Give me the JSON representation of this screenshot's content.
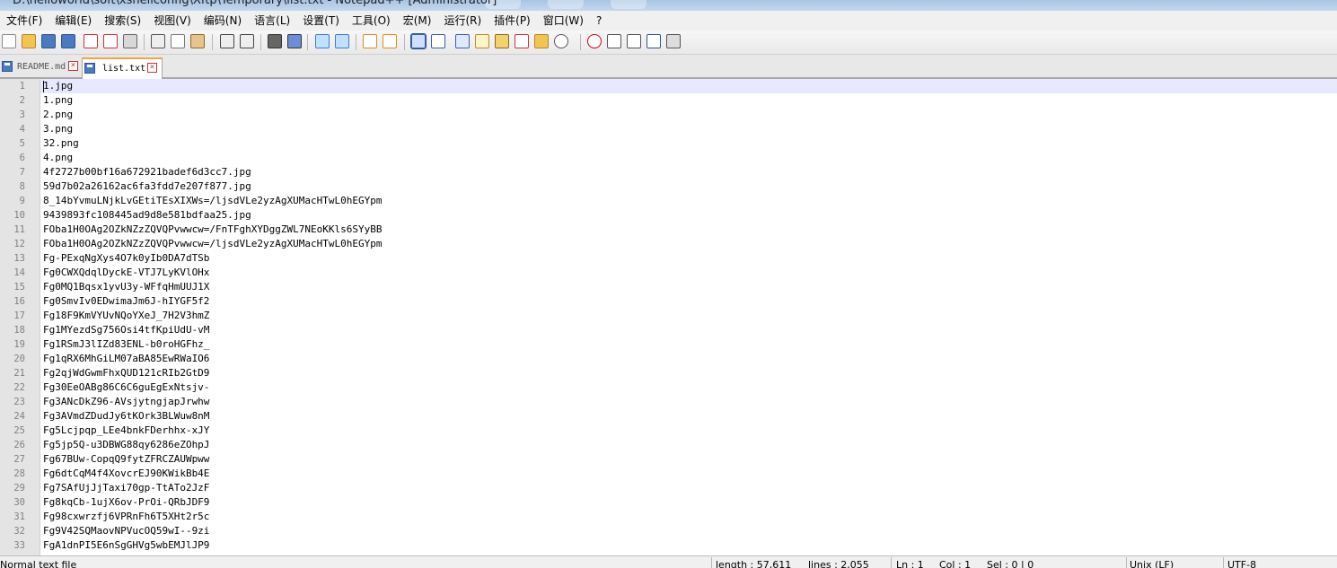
{
  "window": {
    "title": "D:\\helloworld\\soft\\xshellconfig\\Xftp\\Temporary\\list.txt - Notepad++ [Administrator]"
  },
  "menu": [
    "文件(F)",
    "编辑(E)",
    "搜索(S)",
    "视图(V)",
    "编码(N)",
    "语言(L)",
    "设置(T)",
    "工具(O)",
    "宏(M)",
    "运行(R)",
    "插件(P)",
    "窗口(W)",
    "?"
  ],
  "toolbar": {
    "icons": [
      "new-file-icon",
      "open-file-icon",
      "save-icon",
      "save-all-icon",
      "close-icon",
      "close-all-icon",
      "print-icon",
      "cut-icon",
      "copy-icon",
      "paste-icon",
      "undo-icon",
      "redo-icon",
      "find-icon",
      "replace-icon",
      "zoom-in-icon",
      "zoom-out-icon",
      "sync-vertical-icon",
      "sync-horizontal-icon",
      "word-wrap-icon",
      "show-all-chars-icon",
      "indent-guide-icon",
      "user-defined-language-icon",
      "document-map-icon",
      "function-list-icon",
      "folder-as-workspace-icon",
      "monitoring-icon",
      "record-macro-icon",
      "stop-record-icon",
      "play-macro-icon",
      "run-macro-multiple-icon",
      "save-macro-icon"
    ]
  },
  "tabs": [
    {
      "label": "README.md",
      "active": false
    },
    {
      "label": "list.txt",
      "active": true
    }
  ],
  "editor": {
    "current_line": 1,
    "lines": [
      "1.jpg",
      "1.png",
      "2.png",
      "3.png",
      "32.png",
      "4.png",
      "4f2727b00bf16a672921badef6d3cc7.jpg",
      "59d7b02a26162ac6fa3fdd7e207f877.jpg",
      "8_14bYvmuLNjkLvGEtiTEsXIXWs=/ljsdVLe2yzAgXUMacHTwL0hEGYpm",
      "9439893fc108445ad9d8e581bdfaa25.jpg",
      "FOba1H0OAg2OZkNZzZQVQPvwwcw=/FnTFghXYDggZWL7NEoKKls6SYyBB",
      "FOba1H0OAg2OZkNZzZQVQPvwwcw=/ljsdVLe2yzAgXUMacHTwL0hEGYpm",
      "Fg-PExqNgXys4O7k0yIb0DA7dTSb",
      "Fg0CWXQdqlDyckE-VTJ7LyKVlOHx",
      "Fg0MQ1Bqsx1yvU3y-WFfqHmUUJ1X",
      "Fg0SmvIv0EDwimaJm6J-hIYGF5f2",
      "Fg18F9KmVYUvNQoYXeJ_7H2V3hmZ",
      "Fg1MYezdSg756Osi4tfKpiUdU-vM",
      "Fg1RSmJ3lIZd83ENL-b0roHGFhz_",
      "Fg1qRX6MhGiLM07aBA85EwRWaIO6",
      "Fg2qjWdGwmFhxQUD121cRIb2GtD9",
      "Fg30EeOABg86C6C6guEgExNtsjv-",
      "Fg3ANcDkZ96-AVsjytngjapJrwhw",
      "Fg3AVmdZDudJy6tKOrk3BLWuw8nM",
      "Fg5Lcjpqp_LEe4bnkFDerhhx-xJY",
      "Fg5jp5Q-u3DBWG88qy6286eZOhpJ",
      "Fg67BUw-CopqQ9fytZFRCZAUWpww",
      "Fg6dtCqM4f4XovcrEJ90KWikBb4E",
      "Fg7SAfUjJjTaxi70gp-TtATo2JzF",
      "Fg8kqCb-1ujX6ov-PrOi-QRbJDF9",
      "Fg98cxwrzfj6VPRnFh6T5XHt2r5c",
      "Fg9V42SQMaovNPVucOQ59wI--9zi",
      "FgA1dnPI5E6nSgGHVg5wbEMJlJP9"
    ]
  },
  "status": {
    "file_type": "Normal text file",
    "length": "length : 57,611",
    "lines": "lines : 2,055",
    "ln": "Ln : 1",
    "col": "Col : 1",
    "sel": "Sel : 0 | 0",
    "eol": "Unix (LF)",
    "encoding": "UTF-8"
  },
  "colors": {
    "tab_active_accent": "#f7a44a",
    "current_line_bg": "#e8e8ff",
    "gutter_bg": "#e4e4e4",
    "line_number": "#808080"
  }
}
